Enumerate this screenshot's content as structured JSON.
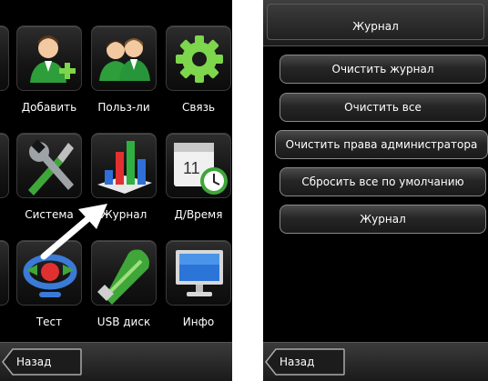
{
  "left_screen": {
    "tiles": [
      {
        "label": "Добавить",
        "icon": "add-user-icon"
      },
      {
        "label": "Польз-ли",
        "icon": "users-icon"
      },
      {
        "label": "Связь",
        "icon": "gear-icon"
      },
      {
        "label": "Система",
        "icon": "wrench-screwdriver-icon"
      },
      {
        "label": "Журнал",
        "icon": "bar-chart-icon"
      },
      {
        "label": "Д/Время",
        "icon": "calendar-clock-icon"
      },
      {
        "label": "Тест",
        "icon": "test-ring-icon"
      },
      {
        "label": "USB диск",
        "icon": "usb-drive-icon"
      },
      {
        "label": "Инфо",
        "icon": "monitor-icon"
      }
    ],
    "back_label": "Назад"
  },
  "right_screen": {
    "title": "Журнал",
    "buttons": [
      "Очистить журнал",
      "Очистить все",
      "Очистить права администратора",
      "Сбросить все по умолчанию",
      "Журнал"
    ],
    "back_label": "Назад"
  },
  "colors": {
    "screen_bg": "#000000",
    "arrow": "#ffffff",
    "accent_green": "#33b54a"
  }
}
